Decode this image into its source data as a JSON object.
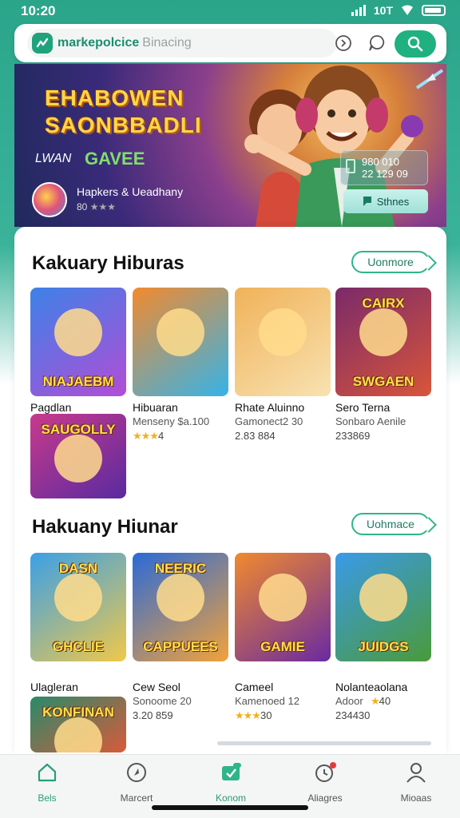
{
  "status_bar": {
    "time": "10:20",
    "right_text": "10T"
  },
  "header": {
    "brand": "markepolcice",
    "search_placeholder": "Binacing",
    "icons": [
      "gamepad-icon",
      "chat-icon",
      "search-icon"
    ]
  },
  "banner": {
    "title_line1": "EHABOWEN",
    "title_line2": "SAONBBADLI",
    "sub_prefix": "LWAN",
    "sub_highlight": "GAVEE",
    "promo_text": "Hapkers & Ueadhany",
    "promo_rating_prefix": "80",
    "info_line1": "980 010",
    "info_line2": "22 129 09",
    "button_label": "Sthnes"
  },
  "sections": [
    {
      "title": "Kakuary Hiburas",
      "more_label": "Uonmore",
      "games": [
        {
          "art_label": "NIAJAEBM",
          "name": "Pagdlan",
          "meta": "",
          "stat": "",
          "stars": "",
          "colors": [
            "#3d82e8",
            "#b24dd6"
          ]
        },
        {
          "art_label": "",
          "name": "Hibuaran",
          "meta": "Menseny $a.100",
          "stat": "",
          "stars": "★★★",
          "rating": "4",
          "colors": [
            "#f28a2e",
            "#36b3e8"
          ]
        },
        {
          "art_label": "",
          "name": "Rhate Aluinno",
          "meta": "Gamonect2 30",
          "stat": "2.83 884",
          "stars": "",
          "colors": [
            "#f0b25a",
            "#f8e2b0"
          ]
        },
        {
          "art_label": "SWGAEN",
          "art_top": "CAIRX",
          "name": "Sero Terna",
          "meta": "Sonbaro Aenile",
          "stat": "233869",
          "stars": "",
          "colors": [
            "#7a2a6a",
            "#d8553a"
          ]
        },
        {
          "art_label": "SAUGOLLY",
          "name": "",
          "meta": "",
          "stat": "",
          "stars": "",
          "colors": [
            "#c83a8c",
            "#5a2aa0"
          ]
        }
      ]
    },
    {
      "title": "Hakuany Hiunar",
      "more_label": "Uohmace",
      "games": [
        {
          "art_label": "GHCLIE",
          "art_top": "DASN",
          "name": "Ulagleran",
          "meta": "",
          "stat": "",
          "stars": "",
          "colors": [
            "#3aa0e8",
            "#f0c84a"
          ]
        },
        {
          "art_label": "CAPPUEES",
          "art_top": "NEERIC",
          "name": "Cew Seol",
          "meta": "Sonoome 20",
          "stat": "3.20 859",
          "stars": "",
          "colors": [
            "#2a6ad8",
            "#f2a23a"
          ]
        },
        {
          "art_label": "GAMIE",
          "name": "Cameel",
          "meta": "Kamenoed 12",
          "stat": "",
          "stars": "★★★",
          "rating": "30",
          "colors": [
            "#f08a2e",
            "#6a2aa0"
          ]
        },
        {
          "art_label": "JUIDGS",
          "name": "Nolanteaolana",
          "meta": "Adoor",
          "stat": "234430",
          "stars": "★",
          "rating": "40",
          "colors": [
            "#3a9ae8",
            "#4a9a3a"
          ]
        },
        {
          "art_label": "KONFINAN",
          "name": "",
          "meta": "",
          "stat": "",
          "stars": "",
          "colors": [
            "#2a8a6a",
            "#d85a3a"
          ]
        }
      ]
    }
  ],
  "nav": [
    {
      "label": "Bels",
      "icon": "home-icon",
      "active": true
    },
    {
      "label": "Marcert",
      "icon": "compass-icon",
      "active": false
    },
    {
      "label": "Konom",
      "icon": "games-icon",
      "active": true
    },
    {
      "label": "Aliagres",
      "icon": "clock-icon",
      "active": false
    },
    {
      "label": "Mioaas",
      "icon": "profile-icon",
      "active": false
    }
  ],
  "colors": {
    "accent": "#1fb17f",
    "brand_text": "#1a8e6e",
    "star": "#f2b01e"
  }
}
